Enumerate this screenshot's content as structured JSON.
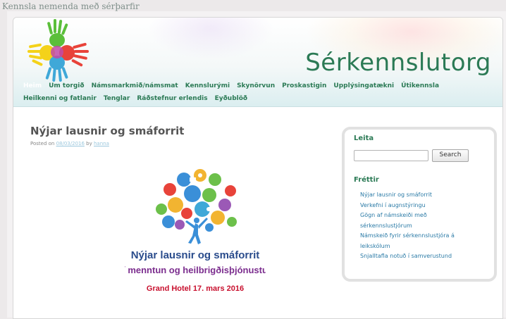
{
  "site": {
    "tagline": "Kennsla nemenda með sérþarfir",
    "title": "Sérkennslutorg"
  },
  "nav": {
    "row1": [
      "Heim",
      "Um torgið",
      "Námsmarkmið/námsmat",
      "Kennslurými",
      "Skynörvun",
      "Proskastigin",
      "Upplýsingatækni",
      "Útikennsla"
    ],
    "row2": [
      "Heilkenni og fatlanir",
      "Tenglar",
      "Ráðstefnur erlendis",
      "Eyðublöð"
    ],
    "active": "Heim"
  },
  "post": {
    "title": "Nýjar lausnir og smáforrit",
    "meta_prefix": "Posted on",
    "date": "08/03/2016",
    "by": "by",
    "author": "hanna",
    "image_line1": "Nýjar lausnir og smáforrit",
    "image_line2": "í menntun og heilbrigðisþjónustu",
    "image_line3": "Grand Hotel  17. mars 2016"
  },
  "sidebar": {
    "search_title": "Leita",
    "search_value": "",
    "search_button": "Search",
    "news_title": "Fréttir",
    "news_items": [
      "Nýjar lausnir og smáforrit",
      "Verkefni í augnstýringu",
      "Gögn af námskeiði með",
      "sérkennslustjórum",
      "Námskeið fyrir sérkennslustjóra á",
      "leikskólum",
      "Snjalltafla notuð í samverustund"
    ]
  },
  "colors": {
    "brand_green": "#2b7a55",
    "link_blue": "#2a7aa6",
    "image_title_blue": "#2a4c8c",
    "image_sub_purple": "#7b2d8e",
    "image_date_red": "#c8102e"
  }
}
